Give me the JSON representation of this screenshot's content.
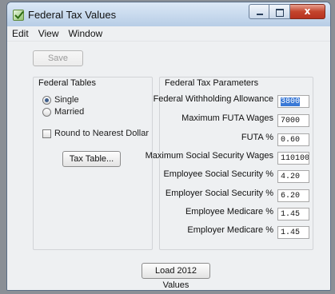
{
  "window": {
    "title": "Federal Tax Values",
    "caption_close_glyph": "x"
  },
  "menu": [
    "Edit",
    "View",
    "Window"
  ],
  "save_label": "Save",
  "federal_tables": {
    "title": "Federal Tables",
    "filing_status": [
      {
        "label": "Single",
        "checked": true
      },
      {
        "label": "Married",
        "checked": false
      }
    ],
    "round_label": "Round to Nearest Dollar",
    "round_checked": false,
    "tax_table_button": "Tax Table..."
  },
  "tax_parameters": {
    "title": "Federal Tax Parameters",
    "fields": [
      {
        "label": "Federal Withholding Allowance",
        "value": "3800",
        "selected": true
      },
      {
        "label": "Maximum FUTA Wages",
        "value": "7000",
        "selected": false
      },
      {
        "label": "FUTA %",
        "value": "0.60",
        "selected": false
      },
      {
        "label": "Maximum Social Security Wages",
        "value": "110100",
        "selected": false
      },
      {
        "label": "Employee Social Security %",
        "value": "4.20",
        "selected": false
      },
      {
        "label": "Employer Social Security %",
        "value": "6.20",
        "selected": false
      },
      {
        "label": "Employee Medicare %",
        "value": "1.45",
        "selected": false
      },
      {
        "label": "Employer Medicare %",
        "value": "1.45",
        "selected": false
      }
    ]
  },
  "load_button": "Load 2012 Values"
}
